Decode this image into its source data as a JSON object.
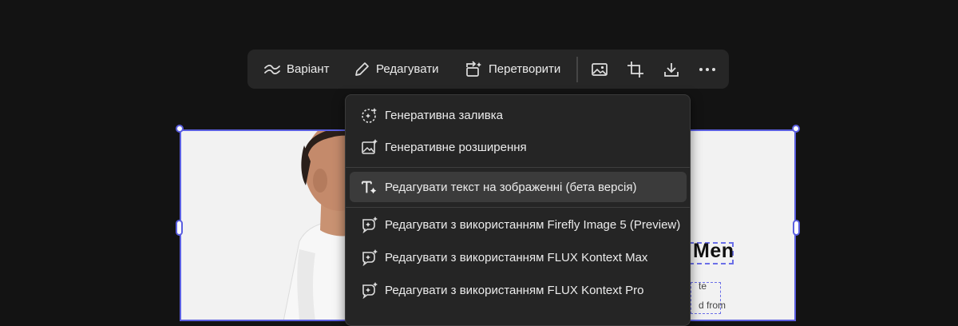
{
  "toolbar": {
    "variant_label": "Варіант",
    "edit_label": "Редагувати",
    "transform_label": "Перетворити",
    "icons": [
      "image-icon",
      "crop-icon",
      "download-icon",
      "more-icon"
    ]
  },
  "menu": {
    "items": [
      {
        "label": "Генеративна заливка",
        "icon": "generative-fill-icon"
      },
      {
        "label": "Генеративне розширення",
        "icon": "generative-expand-icon"
      },
      {
        "label": "Редагувати текст на зображенні (бета версія)",
        "icon": "edit-text-icon",
        "active": true
      },
      {
        "label": "Редагувати з використанням Firefly Image 5 (Preview)",
        "icon": "ai-edit-icon"
      },
      {
        "label": "Редагувати з використанням FLUX Kontext Max",
        "icon": "ai-edit-icon"
      },
      {
        "label": "Редагувати з використанням FLUX Kontext Pro",
        "icon": "ai-edit-icon"
      }
    ]
  },
  "canvas": {
    "headline": "Men",
    "sub_lines": [
      "te",
      "",
      "d from"
    ]
  },
  "colors": {
    "background": "#131313",
    "panel": "#262626",
    "selection": "#5b5fe0"
  }
}
